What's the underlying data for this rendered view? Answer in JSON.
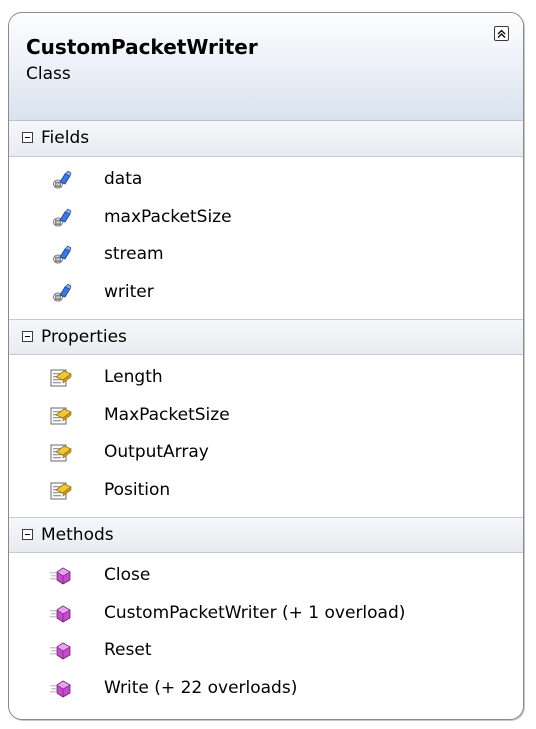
{
  "header": {
    "title": "CustomPacketWriter",
    "subtitle": "Class"
  },
  "sections": {
    "fields": {
      "label": "Fields",
      "icon": "field-icon",
      "items": [
        "data",
        "maxPacketSize",
        "stream",
        "writer"
      ]
    },
    "properties": {
      "label": "Properties",
      "icon": "property-icon",
      "items": [
        "Length",
        "MaxPacketSize",
        "OutputArray",
        "Position"
      ]
    },
    "methods": {
      "label": "Methods",
      "icon": "method-icon",
      "items": [
        "Close",
        "CustomPacketWriter (+ 1 overload)",
        "Reset",
        "Write (+ 22 overloads)"
      ]
    }
  },
  "colors": {
    "field_icon": "#2f64c8",
    "property_icon": "#e0b830",
    "method_icon": "#b03ab8",
    "border": "#8a8a8a"
  }
}
